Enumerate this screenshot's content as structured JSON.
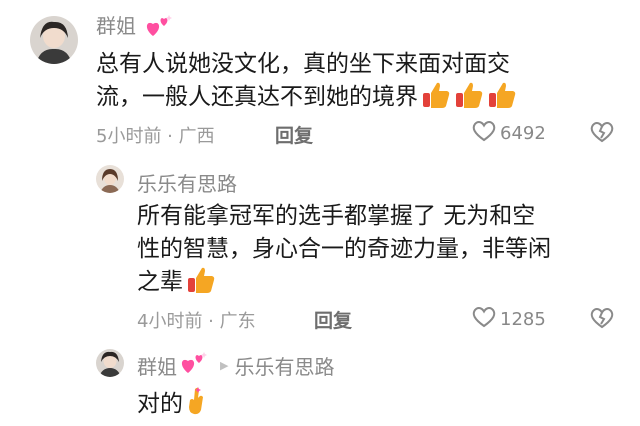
{
  "comment": {
    "author": "群姐",
    "author_badge": "heart-sparkle-emoji",
    "text_line1": "总有人说她没文化，真的坐下来面对面交",
    "text_line2": "流，一般人还真达不到她的境界",
    "text_emojis": [
      "thumbs-up-emoji",
      "thumbs-up-emoji",
      "thumbs-up-emoji"
    ],
    "time_location": "5小时前 · 广西",
    "reply_label": "回复",
    "like_count": "6492"
  },
  "reply1": {
    "author": "乐乐有思路",
    "text_line1": "所有能拿冠军的选手都掌握了 无为和空",
    "text_line2": "性的智慧，身心合一的奇迹力量，非等闲",
    "text_line3": "之辈",
    "text_emojis": [
      "thumbs-up-emoji"
    ],
    "time_location": "4小时前 · 广东",
    "reply_label": "回复",
    "like_count": "1285"
  },
  "reply2": {
    "author": "群姐",
    "author_badge": "heart-sparkle-emoji",
    "reply_to": "乐乐有思路",
    "text": "对的",
    "text_emojis": [
      "crossed-fingers-emoji"
    ]
  },
  "colors": {
    "name": "#8a8a8a",
    "text": "#1a1a1a",
    "meta": "#9a9a9a",
    "emoji_heart": "#ff4fa0",
    "emoji_hand": "#f5a623"
  }
}
